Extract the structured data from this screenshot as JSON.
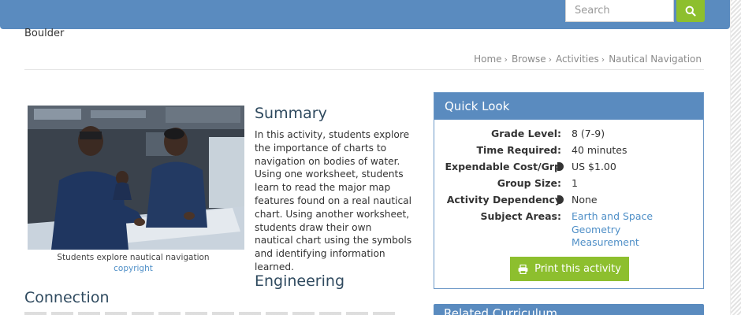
{
  "header": {
    "search_placeholder": "Search",
    "site_name": "Boulder"
  },
  "breadcrumb": [
    "Home",
    "Browse",
    "Activities",
    "Nautical Navigation"
  ],
  "breadcrumb_separator": "›",
  "photo": {
    "caption": "Students explore nautical navigation",
    "credit_link": "copyright"
  },
  "summary": {
    "heading": "Summary",
    "text": "In this activity, students explore the importance of charts to navigation on bodies of water. Using one worksheet, students learn to read the major map features found on a real nautical chart. Using another worksheet, students draw their own nautical chart using the symbols and identifying information learned."
  },
  "engineering_heading": "Engineering",
  "connection_heading": "Connection",
  "quick_look": {
    "title": "Quick Look",
    "rows": [
      {
        "label": "Grade Level:",
        "value": "8 (7-9)"
      },
      {
        "label": "Time Required:",
        "value": "40 minutes"
      },
      {
        "label": "Expendable Cost/Grp",
        "value": "US $1.00"
      },
      {
        "label": "Group Size:",
        "value": "1"
      },
      {
        "label": "Activity Dependency",
        "value": "None"
      }
    ],
    "subject_label": "Subject Areas:",
    "subjects": [
      "Earth and Space",
      "Geometry",
      "Measurement"
    ],
    "print_label": "Print this activity"
  },
  "related_heading": "Related Curriculum",
  "colors": {
    "brand_blue": "#5a8bbf",
    "accent_green": "#8dbf2e",
    "link_blue": "#4f8fc7"
  }
}
